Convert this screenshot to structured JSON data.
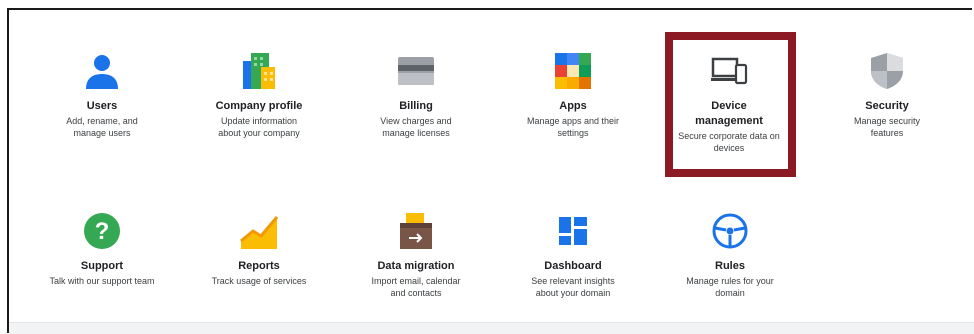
{
  "tiles": {
    "users": {
      "title": "Users",
      "desc": "Add, rename, and manage users"
    },
    "company": {
      "title": "Company profile",
      "desc": "Update information about your company"
    },
    "billing": {
      "title": "Billing",
      "desc": "View charges and manage licenses"
    },
    "apps": {
      "title": "Apps",
      "desc": "Manage apps and their settings"
    },
    "device": {
      "title": "Device management",
      "desc": "Secure corporate data on devices"
    },
    "security": {
      "title": "Security",
      "desc": "Manage security features"
    },
    "support": {
      "title": "Support",
      "desc": "Talk with our support team"
    },
    "reports": {
      "title": "Reports",
      "desc": "Track usage of services"
    },
    "migration": {
      "title": "Data migration",
      "desc": "Import email, calendar and contacts"
    },
    "dashboard": {
      "title": "Dashboard",
      "desc": "See relevant insights about your domain"
    },
    "rules": {
      "title": "Rules",
      "desc": "Manage rules for your domain"
    }
  },
  "colors": {
    "highlight_border": "#8b1a24",
    "blue": "#1a73e8",
    "green": "#34a853",
    "yellow": "#fbbc04",
    "red": "#ea4335",
    "grey": "#5f6368"
  },
  "icons": {
    "users": "person-icon",
    "company": "building-icon",
    "billing": "credit-card-icon",
    "apps": "app-grid-icon",
    "device": "devices-icon",
    "security": "shield-icon",
    "support": "help-icon",
    "reports": "trend-chart-icon",
    "migration": "archive-box-icon",
    "dashboard": "dashboard-icon",
    "rules": "steering-wheel-icon"
  }
}
